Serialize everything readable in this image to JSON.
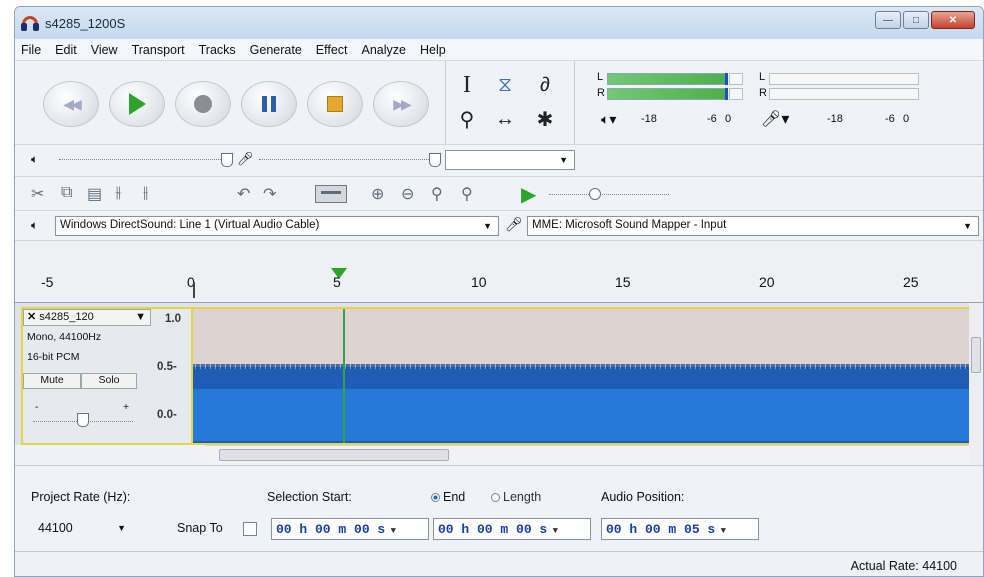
{
  "window": {
    "title": "s4285_1200S",
    "accent": "#1f5cb5"
  },
  "menu": [
    "File",
    "Edit",
    "View",
    "Transport",
    "Tracks",
    "Generate",
    "Effect",
    "Analyze",
    "Help"
  ],
  "transport": {
    "buttons": [
      "skip-to-start",
      "play",
      "record",
      "pause",
      "stop",
      "skip-to-end"
    ]
  },
  "tools": [
    "selection-tool",
    "envelope-tool",
    "draw-tool",
    "zoom-tool",
    "time-shift-tool",
    "multi-tool"
  ],
  "meters": {
    "channel_left": "L",
    "channel_right": "R",
    "output_scale": [
      "-18",
      "-6",
      "0"
    ],
    "input_scale": [
      "-18",
      "-6",
      "0"
    ]
  },
  "devices": {
    "output": "Windows DirectSound: Line 1 (Virtual Audio Cable)",
    "input": "MME: Microsoft Sound Mapper - Input"
  },
  "ruler": {
    "labels": [
      "-5",
      "0",
      "5",
      "10",
      "15",
      "20",
      "25"
    ]
  },
  "track": {
    "name": "s4285_120",
    "info_line1": "Mono, 44100Hz",
    "info_line2": "16-bit PCM",
    "mute": "Mute",
    "solo": "Solo",
    "gain_minus": "-",
    "gain_plus": "+",
    "scale": [
      "1.0",
      "0.5-",
      "0.0-"
    ]
  },
  "selection_bar": {
    "project_rate_label": "Project Rate (Hz):",
    "project_rate_value": "44100",
    "snap_to_label": "Snap To",
    "selection_start_label": "Selection Start:",
    "end_label": "End",
    "length_label": "Length",
    "audio_position_label": "Audio Position:",
    "start_time": "00 h 00 m 00 s",
    "end_time": "00 h 00 m 00 s",
    "audio_position": "00 h 00 m 05 s"
  },
  "status": {
    "actual_rate": "Actual Rate: 44100"
  }
}
